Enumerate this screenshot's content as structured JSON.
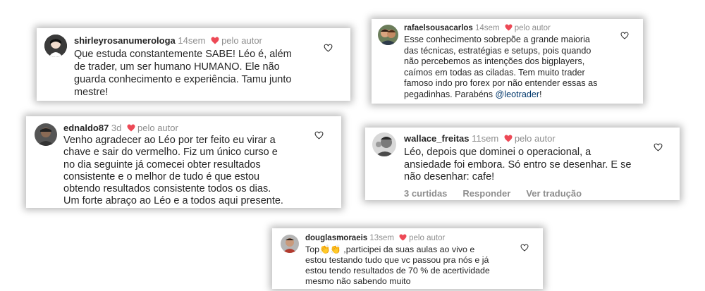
{
  "comments": [
    {
      "username": "shirleyrosanumerologa",
      "time": "14sem",
      "author_badge": "pelo autor",
      "lines": [
        "Que estuda constantemente SABE! Léo é, além",
        "de trader, um ser humano HUMANO. Ele não",
        "guarda conhecimento e experiência. Tamu junto",
        "mestre!"
      ]
    },
    {
      "username": "rafaelsousacarlos",
      "time": "14sem",
      "author_badge": "pelo autor",
      "lines": [
        "Esse conhecimento sobrepõe a grande maioria",
        "das técnicas, estratégias e setups, pois quando",
        "não percebemos as intenções dos bigplayers,",
        "caímos em todas as ciladas. Tem muito trader",
        "famoso indo pro forex por não entender essas as"
      ],
      "last_line_prefix": "pegadinhas. Parabéns ",
      "mention": "@leotrader",
      "last_line_suffix": "!"
    },
    {
      "username": "ednaldo87",
      "time": "3d",
      "author_badge": "pelo autor",
      "lines": [
        "Venho agradecer ao Léo por ter feito eu virar a",
        "chave e sair do vermelho. Fiz um único curso e",
        "no dia seguinte já comecei obter resultados",
        "consistente e o melhor de tudo é que estou",
        "obtendo resultados consistente todos os dias.",
        "Um forte abraço ao Léo e a todos aqui presente."
      ]
    },
    {
      "username": "wallace_freitas",
      "time": "11sem",
      "author_badge": "pelo autor",
      "lines": [
        "Léo, depois que dominei o operacional,  a",
        "ansiedade foi embora. Só entro se desenhar. E se",
        "não desenhar: cafe!"
      ],
      "actions": [
        "3 curtidas",
        "Responder",
        "Ver tradução"
      ]
    },
    {
      "username": "douglasmoraeis",
      "time": "13sem",
      "author_badge": "pelo autor",
      "first_line_prefix": "Top",
      "emoji": "👏👏",
      "first_line_suffix": " ,participei da suas aulas ao vivo e",
      "lines": [
        "estou testando tudo que vc passou pra nós e já",
        "estou tendo resultados  de 70 % de acertividade",
        "mesmo não sabendo muito"
      ]
    }
  ],
  "colors": {
    "heart": "#ed4956",
    "text": "#262626",
    "meta": "#8e8e8e",
    "mention": "#00376b"
  },
  "icons": {
    "author_heart": "heart-filled-icon",
    "like": "heart-outline-icon"
  }
}
